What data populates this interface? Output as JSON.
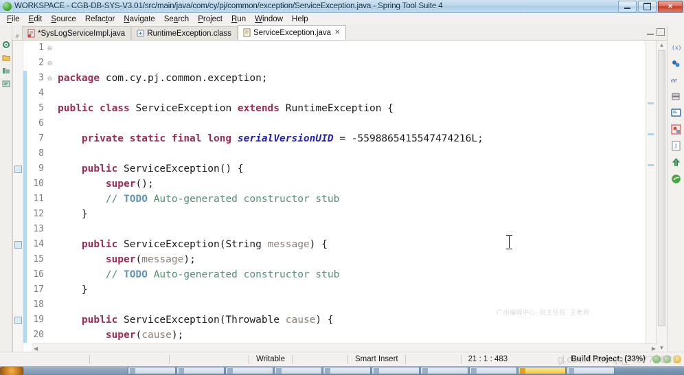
{
  "window": {
    "title": "WORKSPACE - CGB-DB-SYS-V3.01/src/main/java/com/cy/pj/common/exception/ServiceException.java - Spring Tool Suite 4",
    "app_icon": "spring-leaf-icon",
    "minimize_label": "Minimize",
    "maximize_label": "Restore",
    "close_label": "Close"
  },
  "menubar": {
    "items": [
      {
        "label": "File",
        "mnemonic": "F"
      },
      {
        "label": "Edit",
        "mnemonic": "E"
      },
      {
        "label": "Source",
        "mnemonic": "S"
      },
      {
        "label": "Refactor",
        "mnemonic": "t"
      },
      {
        "label": "Navigate",
        "mnemonic": "N"
      },
      {
        "label": "Search",
        "mnemonic": "a"
      },
      {
        "label": "Project",
        "mnemonic": "P"
      },
      {
        "label": "Run",
        "mnemonic": "R"
      },
      {
        "label": "Window",
        "mnemonic": "W"
      },
      {
        "label": "Help",
        "mnemonic": "H"
      }
    ]
  },
  "tabs": [
    {
      "label": "*SysLogServiceImpl.java",
      "icon": "java-file-dirty-icon",
      "active": false,
      "closable": false
    },
    {
      "label": "RuntimeException.class",
      "icon": "class-file-icon",
      "active": false,
      "closable": false
    },
    {
      "label": "ServiceException.java",
      "icon": "java-file-icon",
      "active": true,
      "closable": true,
      "close_glyph": "✕"
    }
  ],
  "editor": {
    "file": "ServiceException.java",
    "first_line": 1,
    "lines": [
      {
        "n": 1,
        "fold": "",
        "tokens": [
          {
            "t": "kw",
            "v": "package"
          },
          {
            "t": "plain",
            "v": " com.cy.pj.common.exception;"
          }
        ]
      },
      {
        "n": 2,
        "fold": "",
        "tokens": []
      },
      {
        "n": 3,
        "fold": "",
        "tokens": [
          {
            "t": "kw",
            "v": "public class"
          },
          {
            "t": "plain",
            "v": " ServiceException "
          },
          {
            "t": "kw",
            "v": "extends"
          },
          {
            "t": "plain",
            "v": " RuntimeException {"
          }
        ]
      },
      {
        "n": 4,
        "fold": "",
        "tokens": []
      },
      {
        "n": 5,
        "fold": "",
        "tokens": [
          {
            "t": "plain",
            "v": "    "
          },
          {
            "t": "kw",
            "v": "private static final long"
          },
          {
            "t": "plain",
            "v": " "
          },
          {
            "t": "fld",
            "v": "serialVersionUID"
          },
          {
            "t": "plain",
            "v": " = -5598865415547474216L;"
          }
        ]
      },
      {
        "n": 6,
        "fold": "",
        "tokens": []
      },
      {
        "n": 7,
        "fold": "⊖",
        "tokens": [
          {
            "t": "plain",
            "v": "    "
          },
          {
            "t": "kw",
            "v": "public"
          },
          {
            "t": "plain",
            "v": " ServiceException() {"
          }
        ]
      },
      {
        "n": 8,
        "fold": "",
        "tokens": [
          {
            "t": "plain",
            "v": "        "
          },
          {
            "t": "kw",
            "v": "super"
          },
          {
            "t": "plain",
            "v": "();"
          }
        ]
      },
      {
        "n": 9,
        "fold": "",
        "tokens": [
          {
            "t": "plain",
            "v": "        "
          },
          {
            "t": "cmt",
            "v": "// "
          },
          {
            "t": "todo",
            "v": "TODO"
          },
          {
            "t": "cmt",
            "v": " Auto-generated constructor stub"
          }
        ]
      },
      {
        "n": 10,
        "fold": "",
        "tokens": [
          {
            "t": "plain",
            "v": "    }"
          }
        ]
      },
      {
        "n": 11,
        "fold": "",
        "tokens": []
      },
      {
        "n": 12,
        "fold": "⊖",
        "tokens": [
          {
            "t": "plain",
            "v": "    "
          },
          {
            "t": "kw",
            "v": "public"
          },
          {
            "t": "plain",
            "v": " ServiceException(String "
          },
          {
            "t": "parm",
            "v": "message"
          },
          {
            "t": "plain",
            "v": ") {"
          }
        ]
      },
      {
        "n": 13,
        "fold": "",
        "tokens": [
          {
            "t": "plain",
            "v": "        "
          },
          {
            "t": "kw",
            "v": "super"
          },
          {
            "t": "plain",
            "v": "("
          },
          {
            "t": "parm",
            "v": "message"
          },
          {
            "t": "plain",
            "v": ");"
          }
        ]
      },
      {
        "n": 14,
        "fold": "",
        "tokens": [
          {
            "t": "plain",
            "v": "        "
          },
          {
            "t": "cmt",
            "v": "// "
          },
          {
            "t": "todo",
            "v": "TODO"
          },
          {
            "t": "cmt",
            "v": " Auto-generated constructor stub"
          }
        ]
      },
      {
        "n": 15,
        "fold": "",
        "tokens": [
          {
            "t": "plain",
            "v": "    }"
          }
        ]
      },
      {
        "n": 16,
        "fold": "",
        "tokens": []
      },
      {
        "n": 17,
        "fold": "⊖",
        "tokens": [
          {
            "t": "plain",
            "v": "    "
          },
          {
            "t": "kw",
            "v": "public"
          },
          {
            "t": "plain",
            "v": " ServiceException(Throwable "
          },
          {
            "t": "parm",
            "v": "cause"
          },
          {
            "t": "plain",
            "v": ") {"
          }
        ]
      },
      {
        "n": 18,
        "fold": "",
        "tokens": [
          {
            "t": "plain",
            "v": "        "
          },
          {
            "t": "kw",
            "v": "super"
          },
          {
            "t": "plain",
            "v": "("
          },
          {
            "t": "parm",
            "v": "cause"
          },
          {
            "t": "plain",
            "v": ");"
          }
        ]
      },
      {
        "n": 19,
        "fold": "",
        "tokens": [
          {
            "t": "plain",
            "v": "        "
          },
          {
            "t": "cmt",
            "v": "// "
          },
          {
            "t": "todo",
            "v": "TODO"
          },
          {
            "t": "cmt",
            "v": " Auto-generated constructor stub"
          }
        ]
      },
      {
        "n": 20,
        "fold": "",
        "tokens": [
          {
            "t": "plain",
            "v": "    }"
          }
        ]
      }
    ],
    "todo_marker_lines": [
      9,
      14,
      19
    ],
    "change_bar_ranges": [
      {
        "from": 3,
        "to": 20
      }
    ],
    "watermark_center": "广州编程中心-班主任任-王老师"
  },
  "left_view_icons": [
    {
      "name": "package-explorer-icon"
    },
    {
      "name": "project-explorer-icon"
    },
    {
      "name": "boot-dashboard-icon"
    },
    {
      "name": "outline-icon"
    }
  ],
  "right_view_icons": [
    {
      "name": "variables-icon"
    },
    {
      "name": "breakpoints-icon"
    },
    {
      "name": "expressions-icon"
    },
    {
      "name": "servers-icon"
    },
    {
      "name": "console-icon"
    },
    {
      "name": "problems-icon"
    },
    {
      "name": "javadoc-icon"
    },
    {
      "name": "boot-dashboard-icon"
    },
    {
      "name": "spring-icon"
    }
  ],
  "editor_toolbar": {
    "minimize_label": "Minimize",
    "maximize_label": "Maximize"
  },
  "scrollbars": {
    "vertical_up_glyph": "▲",
    "vertical_down_glyph": "▼",
    "horizontal_left_glyph": "◀",
    "horizontal_right_glyph": "▶"
  },
  "statusbar": {
    "writable": "Writable",
    "insert_mode": "Smart Insert",
    "cursor_position": "21 : 1 : 483",
    "build_status": "Build Project: (33%)",
    "watermark": "g.csdn.net/qq_43776881"
  },
  "colors": {
    "keyword": "#9e2a56",
    "field": "#2020c0",
    "comment": "#4f9070",
    "todo": "#5f93b8",
    "parameter": "#8a7f74",
    "change_bar": "#b3daf0",
    "titlebar": "#bcd7ec",
    "close_button": "#c63a22"
  },
  "taskbar": {
    "start_label": "Start",
    "buttons": [
      {
        "name": "taskbar-item-1",
        "highlight": false
      },
      {
        "name": "taskbar-item-2",
        "highlight": false
      },
      {
        "name": "taskbar-item-3",
        "highlight": false
      },
      {
        "name": "taskbar-item-4",
        "highlight": false
      },
      {
        "name": "taskbar-item-5",
        "highlight": false
      },
      {
        "name": "taskbar-item-6",
        "highlight": false
      },
      {
        "name": "taskbar-item-7",
        "highlight": false
      },
      {
        "name": "taskbar-item-8",
        "highlight": false
      },
      {
        "name": "taskbar-item-9",
        "highlight": true
      },
      {
        "name": "taskbar-item-10",
        "highlight": false
      }
    ]
  }
}
